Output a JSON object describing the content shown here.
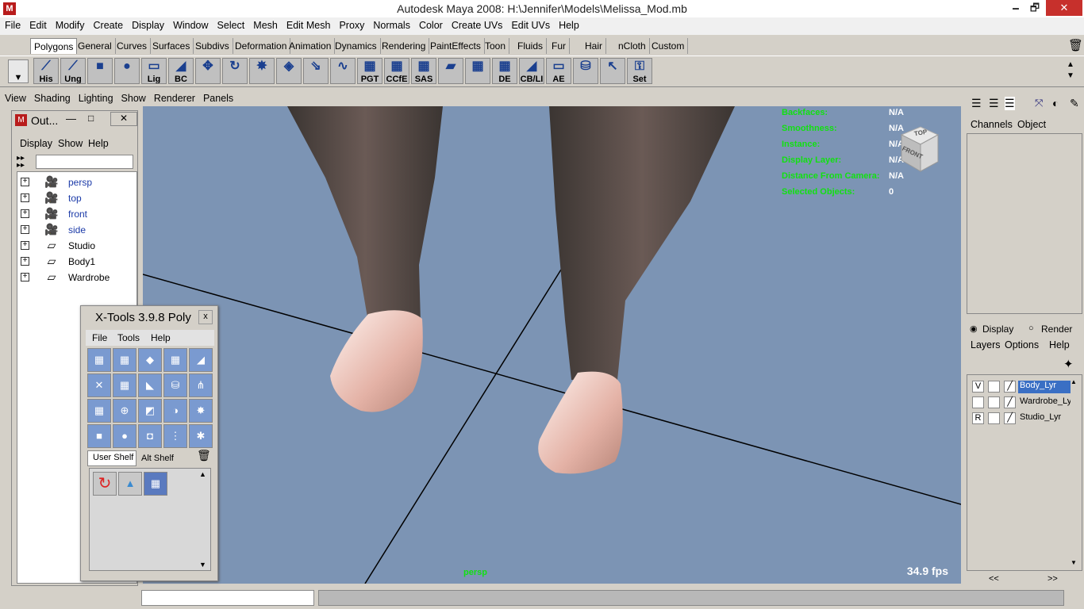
{
  "window": {
    "title": "Autodesk Maya 2008: H:\\Jennifer\\Models\\Melissa_Mod.mb",
    "minimize": "🗕",
    "restore": "🗗",
    "close": "✕"
  },
  "menu": [
    "File",
    "Edit",
    "Modify",
    "Create",
    "Display",
    "Window",
    "Select",
    "Mesh",
    "Edit Mesh",
    "Proxy",
    "Normals",
    "Color",
    "Create UVs",
    "Edit UVs",
    "Help"
  ],
  "shelf_tabs": [
    "Polygons",
    "General",
    "Curves",
    "Surfaces",
    "Subdivs",
    "Deformation",
    "Animation",
    "Dynamics",
    "Rendering",
    "PaintEffects",
    "Toon",
    "Fluids",
    "Fur",
    "Hair",
    "nCloth",
    "Custom"
  ],
  "shelf_tools": [
    {
      "label": "His",
      "icon": "history-icon"
    },
    {
      "label": "Ung",
      "icon": "ungroup-icon"
    },
    {
      "label": "",
      "icon": "cube-icon"
    },
    {
      "label": "",
      "icon": "sphere-icon"
    },
    {
      "label": "Lig",
      "icon": "light-icon"
    },
    {
      "label": "BC",
      "icon": "bc-icon"
    },
    {
      "label": "",
      "icon": "transform-icon"
    },
    {
      "label": "",
      "icon": "rotate-icon"
    },
    {
      "label": "",
      "icon": "star-icon"
    },
    {
      "label": "",
      "icon": "plane-icon"
    },
    {
      "label": "",
      "icon": "normals-icon"
    },
    {
      "label": "",
      "icon": "curve-icon"
    },
    {
      "label": "PGT",
      "icon": "pgt-icon"
    },
    {
      "label": "CCfE",
      "icon": "ccfe-icon"
    },
    {
      "label": "SAS",
      "icon": "sas-icon"
    },
    {
      "label": "",
      "icon": "uv-icon"
    },
    {
      "label": "",
      "icon": "grid-icon"
    },
    {
      "label": "DE",
      "icon": "de-icon"
    },
    {
      "label": "CB/LI",
      "icon": "cbli-icon"
    },
    {
      "label": "AE",
      "icon": "ae-icon"
    },
    {
      "label": "",
      "icon": "cylinder-icon"
    },
    {
      "label": "",
      "icon": "select-icon"
    },
    {
      "label": "Set",
      "icon": "key-icon"
    }
  ],
  "viewport_menu": [
    "View",
    "Shading",
    "Lighting",
    "Show",
    "Renderer",
    "Panels"
  ],
  "hud": [
    {
      "label": "Backfaces:",
      "value": "N/A"
    },
    {
      "label": "Smoothness:",
      "value": "N/A"
    },
    {
      "label": "Instance:",
      "value": "N/A"
    },
    {
      "label": "Display Layer:",
      "value": "N/A"
    },
    {
      "label": "Distance From Camera:",
      "value": "N/A"
    },
    {
      "label": "Selected Objects:",
      "value": "0"
    }
  ],
  "viewcube": {
    "top": "TOP",
    "front": "FRONT"
  },
  "camera_name": "persp",
  "fps": "34.9 fps",
  "outliner": {
    "title": "Out...",
    "menu": [
      "Display",
      "Show",
      "Help"
    ],
    "search_value": "",
    "items": [
      {
        "label": "persp",
        "type": "camera"
      },
      {
        "label": "top",
        "type": "camera"
      },
      {
        "label": "front",
        "type": "camera"
      },
      {
        "label": "side",
        "type": "camera"
      },
      {
        "label": "Studio",
        "type": "group"
      },
      {
        "label": "Body1",
        "type": "group"
      },
      {
        "label": "Wardrobe",
        "type": "group"
      }
    ]
  },
  "xtools": {
    "title": "X-Tools 3.9.8 Poly",
    "close": "x",
    "menu": [
      "File",
      "Tools",
      "Help"
    ],
    "tabs": [
      "User Shelf",
      "Alt Shelf"
    ]
  },
  "right_panel": {
    "channel_tabs": [
      "Channels",
      "Object"
    ],
    "display_radio": "Display",
    "render_radio": "Render",
    "layer_menu": [
      "Layers",
      "Options",
      "Help"
    ],
    "layers": [
      {
        "flag": "V",
        "name": "Body_Lyr",
        "selected": true
      },
      {
        "flag": "",
        "name": "Wardrobe_Ly",
        "selected": false
      },
      {
        "flag": "R",
        "name": "Studio_Lyr",
        "selected": false
      }
    ],
    "nav_prev": "<<",
    "nav_next": ">>"
  },
  "colors": {
    "viewport_bg": "#7c94b4",
    "hud_green": "#12e012",
    "selection": "#3a6fc4"
  }
}
